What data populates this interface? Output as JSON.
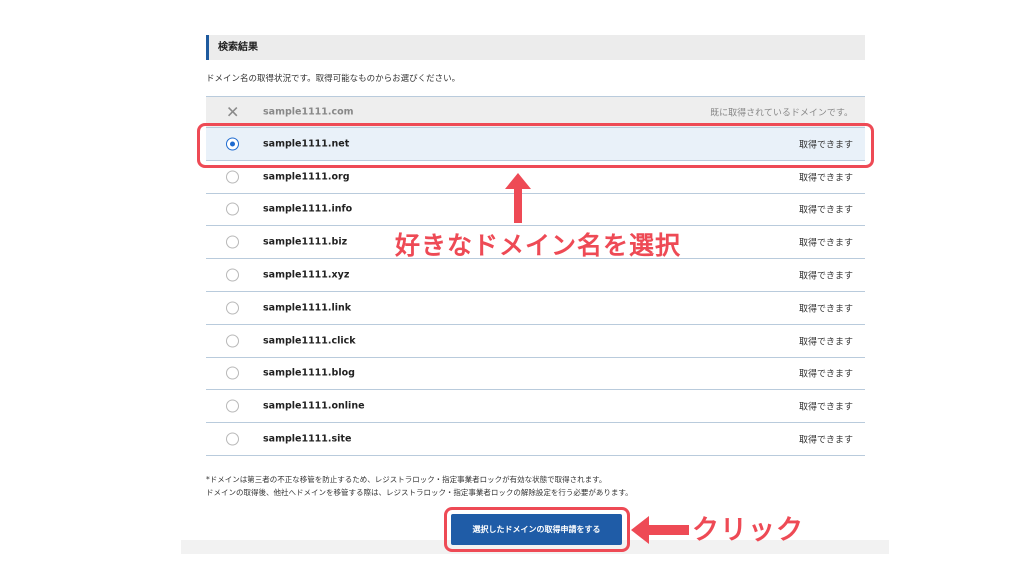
{
  "section": {
    "title": "検索結果",
    "description": "ドメイン名の取得状況です。取得可能なものからお選びください。"
  },
  "domains": [
    {
      "name": "sample1111.com",
      "status": "既に取得されているドメインです。",
      "state": "taken"
    },
    {
      "name": "sample1111.net",
      "status": "取得できます",
      "state": "selected"
    },
    {
      "name": "sample1111.org",
      "status": "取得できます",
      "state": "available"
    },
    {
      "name": "sample1111.info",
      "status": "取得できます",
      "state": "available"
    },
    {
      "name": "sample1111.biz",
      "status": "取得できます",
      "state": "available"
    },
    {
      "name": "sample1111.xyz",
      "status": "取得できます",
      "state": "available"
    },
    {
      "name": "sample1111.link",
      "status": "取得できます",
      "state": "available"
    },
    {
      "name": "sample1111.click",
      "status": "取得できます",
      "state": "available"
    },
    {
      "name": "sample1111.blog",
      "status": "取得できます",
      "state": "available"
    },
    {
      "name": "sample1111.online",
      "status": "取得できます",
      "state": "available"
    },
    {
      "name": "sample1111.site",
      "status": "取得できます",
      "state": "available"
    }
  ],
  "notes": {
    "line1": "*ドメインは第三者の不正な移管を防止するため、レジストラロック・指定事業者ロックが有効な状態で取得されます。",
    "line2": "ドメインの取得後、他社へドメインを移管する際は、レジストラロック・指定事業者ロックの解除設定を行う必要があります。"
  },
  "submit": {
    "label": "選択したドメインの取得申請をする"
  },
  "annotations": {
    "select_text": "好きなドメイン名を選択",
    "click_text": "クリック",
    "color": "#ee4a55"
  },
  "colors": {
    "accent": "#1f5ca7",
    "radio_checked": "#1e6bd0",
    "header_bg": "#ececec"
  }
}
